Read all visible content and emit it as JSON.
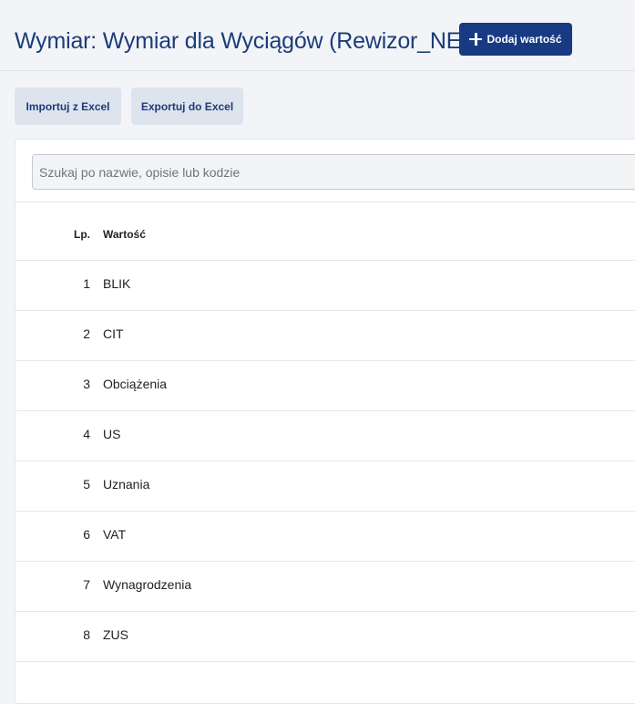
{
  "header": {
    "title": "Wymiar: Wymiar dla Wyciągów (Rewizor_NEXO)",
    "add_label": "Dodaj wartość"
  },
  "toolbar": {
    "import_label": "Importuj z Excel",
    "export_label": "Exportuj do Excel"
  },
  "search": {
    "placeholder": "Szukaj po nazwie, opisie lub kodzie",
    "value": ""
  },
  "table": {
    "columns": [
      "Lp.",
      "Wartość"
    ],
    "rows": [
      {
        "lp": "1",
        "value": "BLIK"
      },
      {
        "lp": "2",
        "value": "CIT"
      },
      {
        "lp": "3",
        "value": "Obciążenia"
      },
      {
        "lp": "4",
        "value": "US"
      },
      {
        "lp": "5",
        "value": "Uznania"
      },
      {
        "lp": "6",
        "value": "VAT"
      },
      {
        "lp": "7",
        "value": "Wynagrodzenia"
      },
      {
        "lp": "8",
        "value": "ZUS"
      }
    ]
  },
  "colors": {
    "primary": "#173a82",
    "title": "#1c3c78",
    "secondary_button_bg": "#dee4ee",
    "page_bg": "#f2f4f8"
  }
}
